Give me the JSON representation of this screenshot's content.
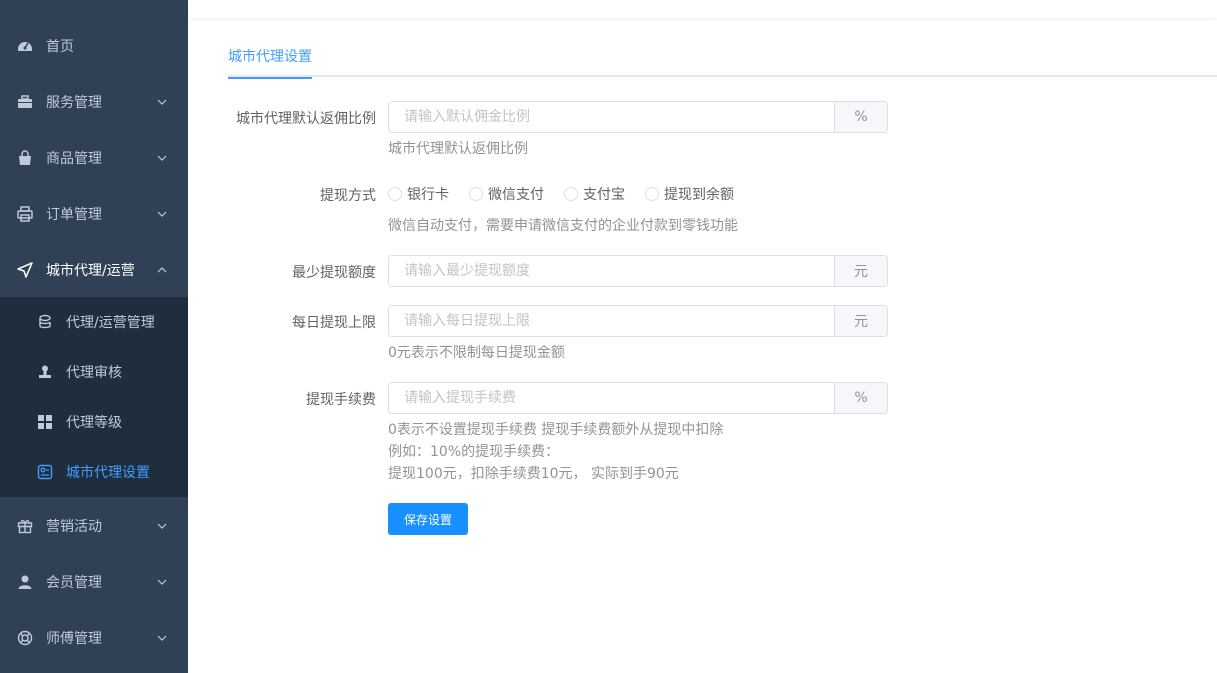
{
  "sidebar": {
    "items": [
      {
        "label": "首页",
        "icon": "dashboard-icon"
      },
      {
        "label": "服务管理",
        "icon": "briefcase-icon"
      },
      {
        "label": "商品管理",
        "icon": "shopping-bag-icon"
      },
      {
        "label": "订单管理",
        "icon": "printer-icon"
      },
      {
        "label": "城市代理/运营",
        "icon": "send-icon"
      },
      {
        "label": "营销活动",
        "icon": "gift-icon"
      },
      {
        "label": "会员管理",
        "icon": "user-icon"
      },
      {
        "label": "师傅管理",
        "icon": "lifebuoy-icon"
      }
    ],
    "submenu": [
      {
        "label": "代理/运营管理",
        "icon": "coins-icon"
      },
      {
        "label": "代理审核",
        "icon": "stamp-icon"
      },
      {
        "label": "代理等级",
        "icon": "grid-icon"
      },
      {
        "label": "城市代理设置",
        "icon": "settings-panel-icon"
      }
    ]
  },
  "tabs": {
    "active": "城市代理设置"
  },
  "form": {
    "rebate": {
      "label": "城市代理默认返佣比例",
      "placeholder": "请输入默认佣金比例",
      "unit": "%",
      "hint": "城市代理默认返佣比例"
    },
    "withdraw_method": {
      "label": "提现方式",
      "options": [
        "银行卡",
        "微信支付",
        "支付宝",
        "提现到余额"
      ],
      "hint": "微信自动支付，需要申请微信支付的企业付款到零钱功能"
    },
    "min_amount": {
      "label": "最少提现额度",
      "placeholder": "请输入最少提现额度",
      "unit": "元"
    },
    "daily_limit": {
      "label": "每日提现上限",
      "placeholder": "请输入每日提现上限",
      "unit": "元",
      "hint": "0元表示不限制每日提现金额"
    },
    "fee": {
      "label": "提现手续费",
      "placeholder": "请输入提现手续费",
      "unit": "%",
      "hint1": "0表示不设置提现手续费 提现手续费额外从提现中扣除",
      "hint2": "例如：10%的提现手续费：",
      "hint3": "提现100元，扣除手续费10元， 实际到手90元"
    },
    "save_label": "保存设置"
  },
  "colors": {
    "sidebar_bg": "#304156",
    "submenu_bg": "#1f2d3d",
    "accent": "#409eff",
    "button": "#1890ff"
  }
}
